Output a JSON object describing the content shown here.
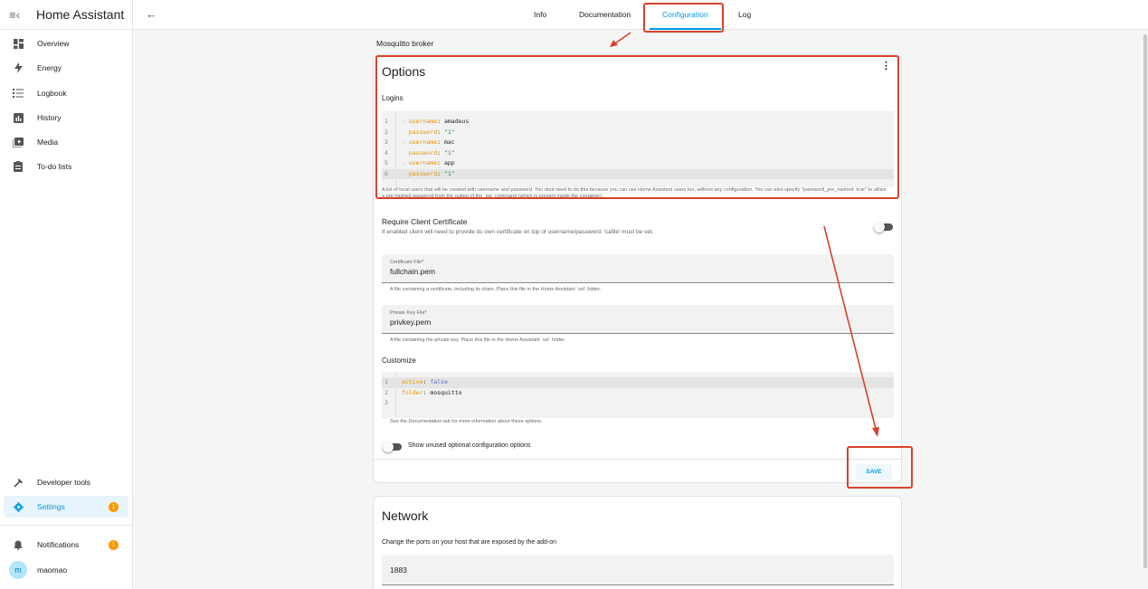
{
  "app": {
    "title": "Home Assistant"
  },
  "sidebar": {
    "items": [
      {
        "label": "Overview",
        "icon": "dashboard-icon"
      },
      {
        "label": "Energy",
        "icon": "lightning-icon"
      },
      {
        "label": "Logbook",
        "icon": "list-icon"
      },
      {
        "label": "History",
        "icon": "chart-icon"
      },
      {
        "label": "Media",
        "icon": "media-icon"
      },
      {
        "label": "To-do lists",
        "icon": "clipboard-icon"
      }
    ],
    "developer_tools": "Developer tools",
    "settings": {
      "label": "Settings",
      "badge": "1"
    },
    "notifications": {
      "label": "Notifications",
      "badge": "1"
    },
    "user": {
      "initial": "m",
      "name": "maomao"
    }
  },
  "tabs": [
    "Info",
    "Documentation",
    "Configuration",
    "Log"
  ],
  "active_tab": "Configuration",
  "breadcrumb": "Mosquitto broker",
  "options": {
    "title": "Options",
    "logins_label": "Logins",
    "logins_code": [
      {
        "n": "1",
        "key": "- username",
        "val": "amadeus"
      },
      {
        "n": "2",
        "key": "  password",
        "val": "\"1\""
      },
      {
        "n": "3",
        "key": "- username",
        "val": "mac"
      },
      {
        "n": "4",
        "key": "  password",
        "val": "\"1\""
      },
      {
        "n": "5",
        "key": "- username",
        "val": "app"
      },
      {
        "n": "6",
        "key": "  password",
        "val": "\"1\""
      }
    ],
    "logins_help": "A list of local users that will be created with username and password. You dont need to do this because you can use Home Assistant users too, without any configuration. You can also specify \"password_pre_hashed: true\" to utilize a pre-hashed password from the output of the `pw` command (which is present inside the container).",
    "require_cert": {
      "title": "Require Client Certificate",
      "desc": "If enabled client will need to provide its own certificate on top of username/password. 'cafile' must be set."
    },
    "certfile": {
      "label": "Certificate File*",
      "value": "fullchain.pem",
      "help": "A file containing a certificate, including its chain. Place this file in the Home Assistant `ssl` folder."
    },
    "keyfile": {
      "label": "Private Key File*",
      "value": "privkey.pem",
      "help": "A file containing the private key. Place this file in the Home Assistant `ssl` folder."
    },
    "customize_label": "Customize",
    "customize_code": [
      {
        "n": "1",
        "key": "active",
        "val": "false"
      },
      {
        "n": "2",
        "key": "folder",
        "val": "mosquitto"
      },
      {
        "n": "3",
        "key": "",
        "val": ""
      }
    ],
    "customize_help": "See the Documentation tab for more information about these options.",
    "show_unused": "Show unused optional configuration options",
    "save": "SAVE"
  },
  "network": {
    "title": "Network",
    "desc": "Change the ports on your host that are exposed by the add-on",
    "port_value": "1883"
  },
  "colors": {
    "accent": "#039be5",
    "annotation": "#d9412b",
    "badge": "#ff9800"
  }
}
